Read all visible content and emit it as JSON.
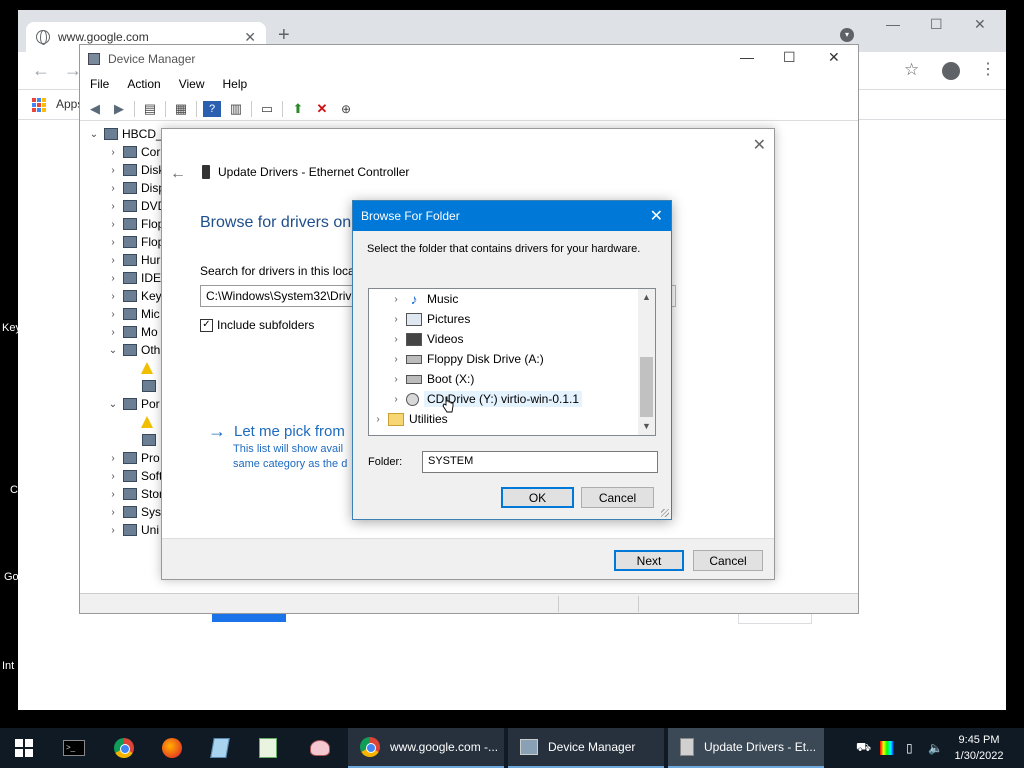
{
  "desktop": {
    "labels": [
      "Key",
      "C",
      "Go",
      "Int"
    ]
  },
  "chrome": {
    "tab_title": "www.google.com",
    "bookmarks_apps": "Apps"
  },
  "devmgr": {
    "title": "Device Manager",
    "menu": [
      "File",
      "Action",
      "View",
      "Help"
    ],
    "tree": [
      {
        "label": "HBCD_",
        "arrow": "⌄",
        "indent": 0
      },
      {
        "label": "Cor",
        "arrow": "›",
        "indent": 1
      },
      {
        "label": "Disk",
        "arrow": "›",
        "indent": 1
      },
      {
        "label": "Disp",
        "arrow": "›",
        "indent": 1
      },
      {
        "label": "DVD",
        "arrow": "›",
        "indent": 1
      },
      {
        "label": "Flop",
        "arrow": "›",
        "indent": 1
      },
      {
        "label": "Flop",
        "arrow": "›",
        "indent": 1
      },
      {
        "label": "Hur",
        "arrow": "›",
        "indent": 1
      },
      {
        "label": "IDE",
        "arrow": "›",
        "indent": 1
      },
      {
        "label": "Key",
        "arrow": "›",
        "indent": 1
      },
      {
        "label": "Mic",
        "arrow": "›",
        "indent": 1
      },
      {
        "label": "Mo",
        "arrow": "›",
        "indent": 1
      },
      {
        "label": "Oth",
        "arrow": "⌄",
        "indent": 1
      },
      {
        "label": "",
        "arrow": "",
        "indent": 2,
        "warn": true
      },
      {
        "label": "",
        "arrow": "",
        "indent": 2
      },
      {
        "label": "Por",
        "arrow": "⌄",
        "indent": 1
      },
      {
        "label": "",
        "arrow": "",
        "indent": 2,
        "warn": true
      },
      {
        "label": "",
        "arrow": "",
        "indent": 2
      },
      {
        "label": "Pro",
        "arrow": "›",
        "indent": 1
      },
      {
        "label": "Soft",
        "arrow": "›",
        "indent": 1
      },
      {
        "label": "Stor",
        "arrow": "›",
        "indent": 1
      },
      {
        "label": "Syst",
        "arrow": "›",
        "indent": 1
      },
      {
        "label": "Uni",
        "arrow": "›",
        "indent": 1
      }
    ]
  },
  "wizard": {
    "title": "Update Drivers - Ethernet Controller",
    "heading": "Browse for drivers on",
    "search_label": "Search for drivers in this loca",
    "path_value": "C:\\Windows\\System32\\Driv",
    "include_subfolders": "Include subfolders",
    "pick_link": "Let me pick from",
    "pick_desc_1": "This list will show avail",
    "pick_desc_2": "same category as the d",
    "next": "Next",
    "cancel": "Cancel"
  },
  "browse_folder": {
    "title": "Browse For Folder",
    "instruction": "Select the folder that contains drivers for your hardware.",
    "items": [
      {
        "label": "Music",
        "icon": "music",
        "level": 1
      },
      {
        "label": "Pictures",
        "icon": "pictures",
        "level": 1
      },
      {
        "label": "Videos",
        "icon": "video",
        "level": 1
      },
      {
        "label": "Floppy Disk Drive (A:)",
        "icon": "drive",
        "level": 1
      },
      {
        "label": "Boot (X:)",
        "icon": "drive",
        "level": 1
      },
      {
        "label": "CD Drive (Y:) virtio-win-0.1.1",
        "icon": "cd",
        "level": 1,
        "selected": true
      },
      {
        "label": "Utilities",
        "icon": "folder",
        "level": 0
      }
    ],
    "folder_label": "Folder:",
    "folder_value": "SYSTEM",
    "ok": "OK",
    "cancel": "Cancel"
  },
  "taskbar": {
    "buttons": [
      {
        "label": "www.google.com -...",
        "icon": "chrome",
        "active": false
      },
      {
        "label": "Device Manager",
        "icon": "devmgr",
        "active": false
      },
      {
        "label": "Update Drivers - Et...",
        "icon": "drivers",
        "active": true
      }
    ],
    "time": "9:45 PM",
    "date": "1/30/2022"
  }
}
